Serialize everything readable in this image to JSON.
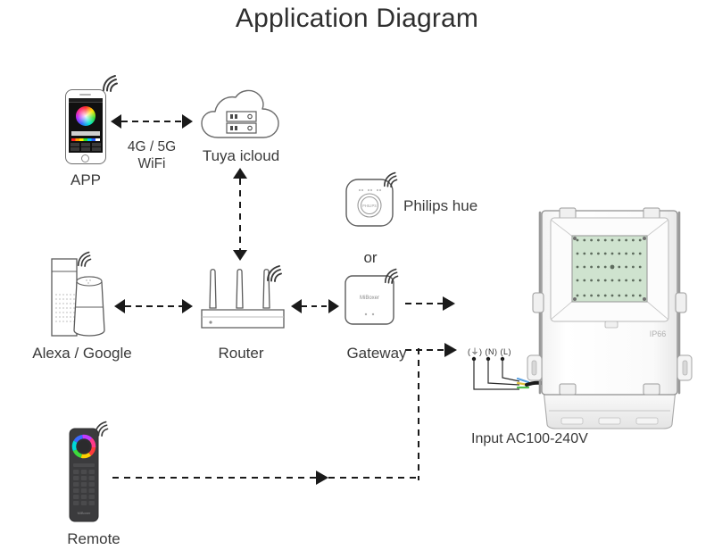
{
  "page": {
    "title": "Application Diagram",
    "background": "#ffffff",
    "text_color": "#3a3a3a"
  },
  "nodes": {
    "app": {
      "label": "APP",
      "icon": "smartphone-icon",
      "has_wifi": true
    },
    "cloud": {
      "label": "Tuya icloud",
      "icon": "cloud-server-icon",
      "has_wifi": false
    },
    "alexa": {
      "label": "Alexa / Google",
      "icon": "smart-speaker-icon",
      "has_wifi": true
    },
    "router": {
      "label": "Router",
      "icon": "router-icon",
      "has_wifi": true
    },
    "gateway": {
      "label": "Gateway",
      "icon": "gateway-icon",
      "brand_text": "MiBoxer",
      "has_wifi": true
    },
    "philips": {
      "label": "Philips hue",
      "icon": "philips-hue-bridge-icon",
      "brand_text": "PHILIPS",
      "has_wifi": true
    },
    "remote": {
      "label": "Remote",
      "icon": "rf-remote-icon",
      "has_wifi": true
    },
    "floodlight": {
      "label": "",
      "icon": "led-floodlight-icon",
      "ip_rating": "IP66"
    }
  },
  "connectors": {
    "app_to_cloud_label_line1": "4G / 5G",
    "app_to_cloud_label_line2": "WiFi",
    "or_label": "or"
  },
  "wiring": {
    "pin_labels": "(⏚) (N) (L)",
    "ground": "(⏚)",
    "neutral": "(N)",
    "live": "(L)",
    "input_label": "Input AC100-240V"
  },
  "colors": {
    "stroke": "#4a4a4a",
    "light_stroke": "#8e8e8e",
    "arrow": "#1a1a1a",
    "title": "#2f2f2f",
    "led_green": "#cfe3cf",
    "remote_body": "#3b3b3d"
  }
}
